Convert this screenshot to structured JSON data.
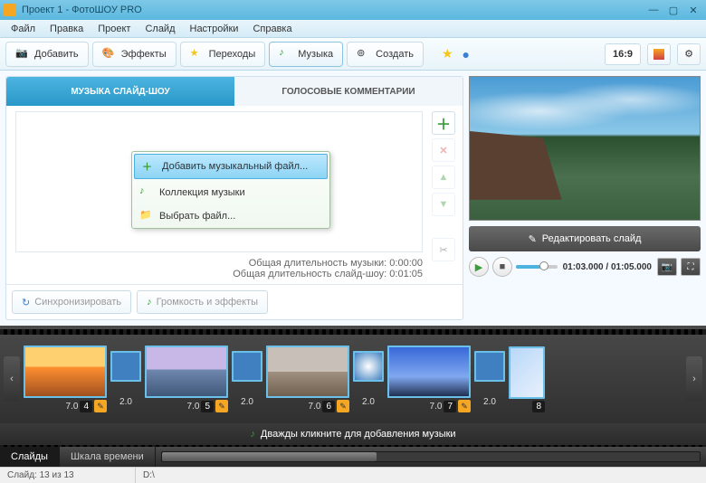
{
  "window": {
    "title": "Проект 1 - ФотоШОУ PRO"
  },
  "menu": {
    "items": [
      "Файл",
      "Правка",
      "Проект",
      "Слайд",
      "Настройки",
      "Справка"
    ]
  },
  "toolbar": {
    "add": "Добавить",
    "effects": "Эффекты",
    "transitions": "Переходы",
    "music": "Музыка",
    "create": "Создать",
    "aspect": "16:9"
  },
  "music_panel": {
    "tab_music": "МУЗЫКА СЛАЙД-ШОУ",
    "tab_voice": "ГОЛОСОВЫЕ КОММЕНТАРИИ",
    "dropdown": {
      "add_file": "Добавить музыкальный файл...",
      "collection": "Коллекция музыки",
      "choose_file": "Выбрать файл..."
    },
    "dur_music_label": "Общая длительность музыки:",
    "dur_music_value": "0:00:00",
    "dur_show_label": "Общая длительность слайд-шоу:",
    "dur_show_value": "0:01:05",
    "sync_btn": "Синхронизировать",
    "volume_btn": "Громкость и эффекты"
  },
  "preview": {
    "edit_slide": "Редактировать слайд",
    "time": "01:03.000 / 01:05.000"
  },
  "timeline": {
    "slides": [
      {
        "num": "4",
        "dur": "7.0"
      },
      {
        "num": "5",
        "dur": "7.0"
      },
      {
        "num": "6",
        "dur": "7.0"
      },
      {
        "num": "7",
        "dur": "7.0"
      },
      {
        "num": "8",
        "dur": ""
      }
    ],
    "trans_dur": "2.0",
    "music_hint": "Дважды кликните для добавления музыки"
  },
  "bottom_tabs": {
    "slides": "Слайды",
    "timeline": "Шкала времени"
  },
  "status": {
    "slide_count": "Слайд: 13 из 13",
    "path": "D:\\"
  }
}
